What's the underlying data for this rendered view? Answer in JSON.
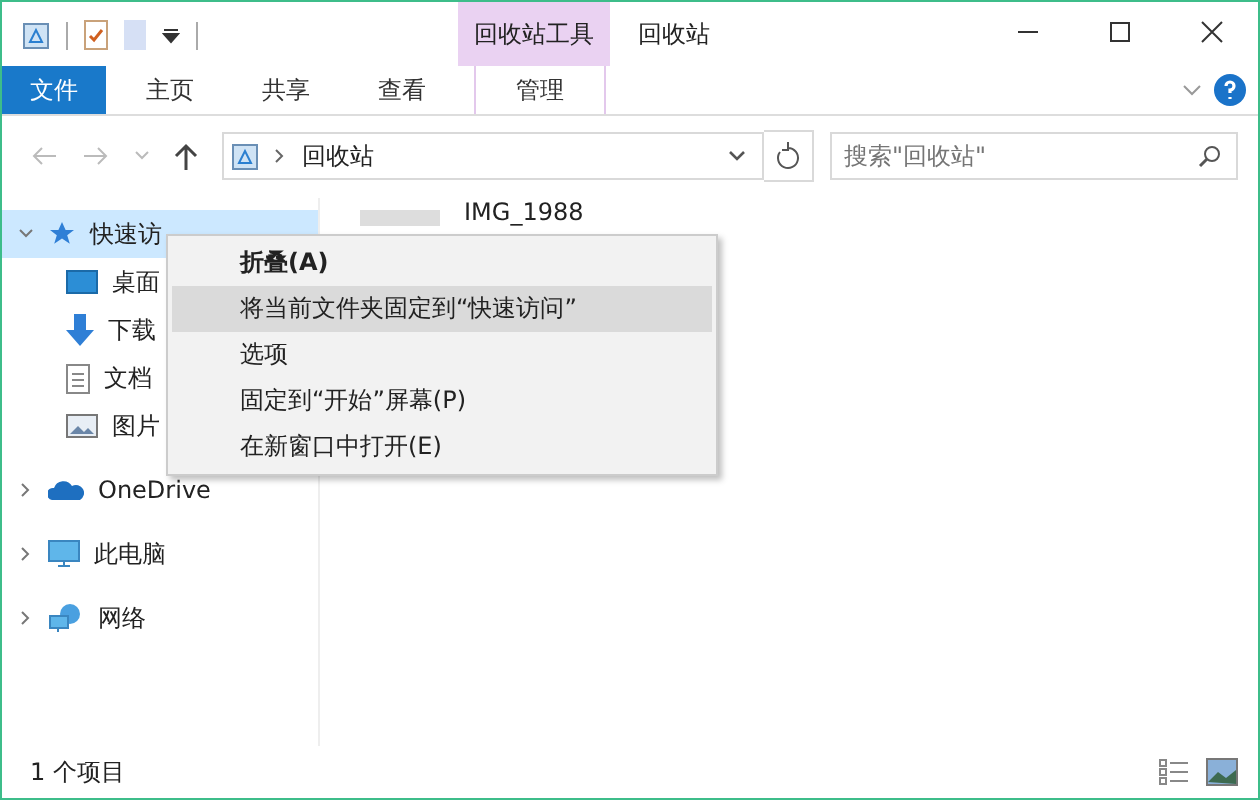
{
  "window": {
    "title": "回收站",
    "contextual_tab_group": "回收站工具"
  },
  "ribbon_tabs": [
    {
      "label": "文件",
      "kind": "file",
      "selected": false
    },
    {
      "label": "主页",
      "kind": "tab",
      "selected": false
    },
    {
      "label": "共享",
      "kind": "tab",
      "selected": false
    },
    {
      "label": "查看",
      "kind": "tab",
      "selected": false
    },
    {
      "label": "管理",
      "kind": "context",
      "selected": false
    }
  ],
  "address": {
    "location": "回收站",
    "search_placeholder": "搜索\"回收站\""
  },
  "nav": [
    {
      "label": "快速访",
      "kind": "star",
      "selected": true,
      "expanded": true,
      "children": [
        {
          "label": "桌面",
          "kind": "desktop"
        },
        {
          "label": "下载",
          "kind": "download"
        },
        {
          "label": "文档",
          "kind": "document"
        },
        {
          "label": "图片",
          "kind": "picture"
        }
      ]
    },
    {
      "label": "OneDrive",
      "kind": "cloud",
      "selected": false,
      "expanded": false
    },
    {
      "label": "此电脑",
      "kind": "pc",
      "selected": false,
      "expanded": false
    },
    {
      "label": "网络",
      "kind": "network",
      "selected": false,
      "expanded": false
    }
  ],
  "files": [
    {
      "name": "IMG_1988"
    }
  ],
  "context_menu": [
    {
      "label": "折叠(A)",
      "bold": true,
      "selected": false
    },
    {
      "label": "将当前文件夹固定到“快速访问”",
      "bold": false,
      "selected": true
    },
    {
      "label": "选项",
      "bold": false,
      "selected": false
    },
    {
      "label": "固定到“开始”屏幕(P)",
      "bold": false,
      "selected": false
    },
    {
      "label": "在新窗口中打开(E)",
      "bold": false,
      "selected": false
    }
  ],
  "status_bar": {
    "text": "1 个项目"
  }
}
